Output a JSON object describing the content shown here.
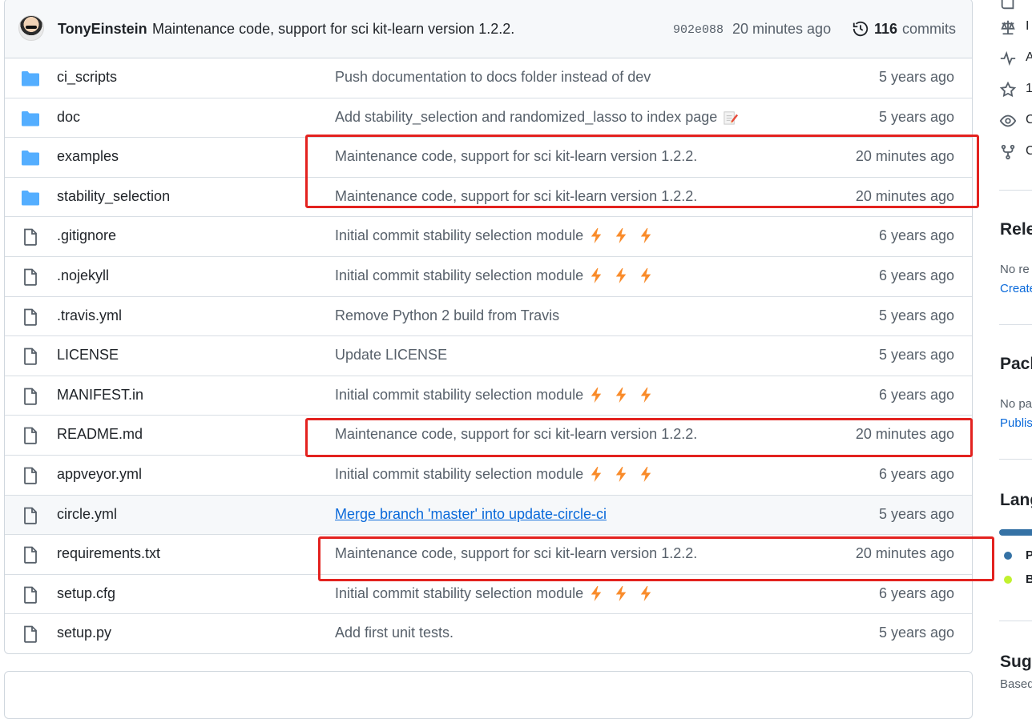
{
  "commit": {
    "author": "TonyEinstein",
    "message": "Maintenance code, support for sci kit-learn version 1.2.2.",
    "sha": "902e088",
    "time": "20 minutes ago",
    "commit_count": "116",
    "commits_label": "commits"
  },
  "files": [
    {
      "type": "folder",
      "name": "ci_scripts",
      "message": "Push documentation to docs folder instead of dev",
      "time": "5 years ago"
    },
    {
      "type": "folder",
      "name": "doc",
      "message": "Add stability_selection and randomized_lasso to index page",
      "time": "5 years ago",
      "emoji": "memo"
    },
    {
      "type": "folder",
      "name": "examples",
      "message": "Maintenance code, support for sci kit-learn version 1.2.2.",
      "time": "20 minutes ago"
    },
    {
      "type": "folder",
      "name": "stability_selection",
      "message": "Maintenance code, support for sci kit-learn version 1.2.2.",
      "time": "20 minutes ago"
    },
    {
      "type": "file",
      "name": ".gitignore",
      "message": "Initial commit stability selection module",
      "time": "6 years ago",
      "emoji": "zap"
    },
    {
      "type": "file",
      "name": ".nojekyll",
      "message": "Initial commit stability selection module",
      "time": "6 years ago",
      "emoji": "zap"
    },
    {
      "type": "file",
      "name": ".travis.yml",
      "message": "Remove Python 2 build from Travis",
      "time": "5 years ago"
    },
    {
      "type": "file",
      "name": "LICENSE",
      "message": "Update LICENSE",
      "time": "5 years ago"
    },
    {
      "type": "file",
      "name": "MANIFEST.in",
      "message": "Initial commit stability selection module",
      "time": "6 years ago",
      "emoji": "zap"
    },
    {
      "type": "file",
      "name": "README.md",
      "message": "Maintenance code, support for sci kit-learn version 1.2.2.",
      "time": "20 minutes ago"
    },
    {
      "type": "file",
      "name": "appveyor.yml",
      "message": "Initial commit stability selection module",
      "time": "6 years ago",
      "emoji": "zap"
    },
    {
      "type": "file",
      "name": "circle.yml",
      "message": "Merge branch 'master' into update-circle-ci",
      "time": "5 years ago",
      "link": true,
      "hover": true
    },
    {
      "type": "file",
      "name": "requirements.txt",
      "message": "Maintenance code, support for sci kit-learn version 1.2.2.",
      "time": "20 minutes ago"
    },
    {
      "type": "file",
      "name": "setup.cfg",
      "message": "Initial commit stability selection module",
      "time": "6 years ago",
      "emoji": "zap"
    },
    {
      "type": "file",
      "name": "setup.py",
      "message": "Add first unit tests.",
      "time": "5 years ago"
    }
  ],
  "sidebar": {
    "icons": [
      "book-icon",
      "law-icon",
      "pulse-icon",
      "star-icon",
      "eye-icon",
      "fork-icon"
    ],
    "icon_fragments": [
      "",
      "I",
      "A",
      "1",
      "C",
      "C"
    ],
    "releases_heading": "Rele",
    "releases_text": "No re",
    "releases_link": "Create",
    "packages_heading": "Pack",
    "packages_text": "No pa",
    "packages_link": "Publis",
    "languages_heading": "Lang",
    "lang1": "P",
    "lang2": "B",
    "suggested_heading": "Sugg",
    "suggested_text": "Based"
  },
  "colors": {
    "folder": "#54aeff",
    "highlight": "#e3221f",
    "lang1": "#3572a5",
    "lang2": "#c1f12e",
    "zap": "#f98b2a"
  }
}
